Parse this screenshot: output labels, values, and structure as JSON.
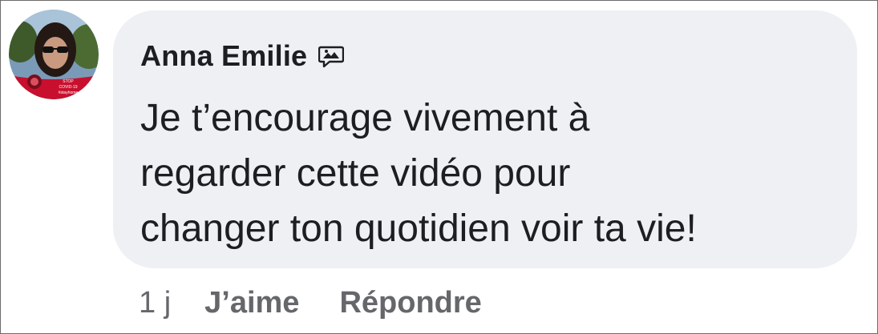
{
  "comment": {
    "author": "Anna Emilie",
    "text": "Je t’encourage vivement à\nregarder cette vidéo pour\nchanger ton quotidien voir ta vie!",
    "badge_icon": "comment-badge-icon",
    "avatar_frame_lines": [
      "STOP",
      "COVID-19",
      "#stayhome"
    ]
  },
  "actions": {
    "timestamp": "1 j",
    "like_label": "J’aime",
    "reply_label": "Répondre"
  },
  "colors": {
    "bubble": "#eef0f4",
    "text": "#1c1e21",
    "secondary_text": "#65676b",
    "avatar_frame": "#c8102e"
  }
}
